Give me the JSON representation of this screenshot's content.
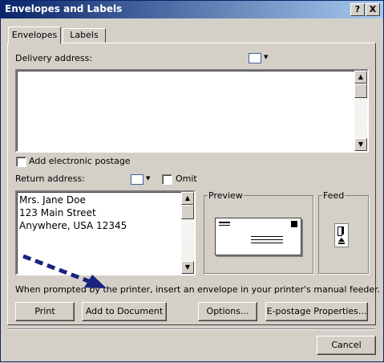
{
  "window": {
    "title": "Envelopes and Labels",
    "help_glyph": "?",
    "close_glyph": "X"
  },
  "tabs": [
    {
      "label": "Envelopes"
    },
    {
      "label": "Labels"
    }
  ],
  "delivery": {
    "label": "Delivery address:",
    "value": "",
    "dropdown_glyph": "▼"
  },
  "electronic_postage": {
    "label": "Add electronic postage",
    "checked": false
  },
  "return": {
    "label": "Return address:",
    "omit_label": "Omit",
    "lines": [
      "Mrs. Jane Doe",
      "123 Main Street",
      "Anywhere, USA 12345"
    ]
  },
  "preview": {
    "label": "Preview"
  },
  "feed": {
    "label": "Feed"
  },
  "message": "When prompted by the printer, insert an envelope in your printer's manual feeder.",
  "buttons": {
    "print": "Print",
    "add_to_document": "Add to Document",
    "options": "Options...",
    "epostage": "E-postage Properties...",
    "cancel": "Cancel"
  },
  "colors": {
    "titlebar": "#0a246a",
    "arrow": "#1a237e",
    "face": "#d4d0c8"
  }
}
